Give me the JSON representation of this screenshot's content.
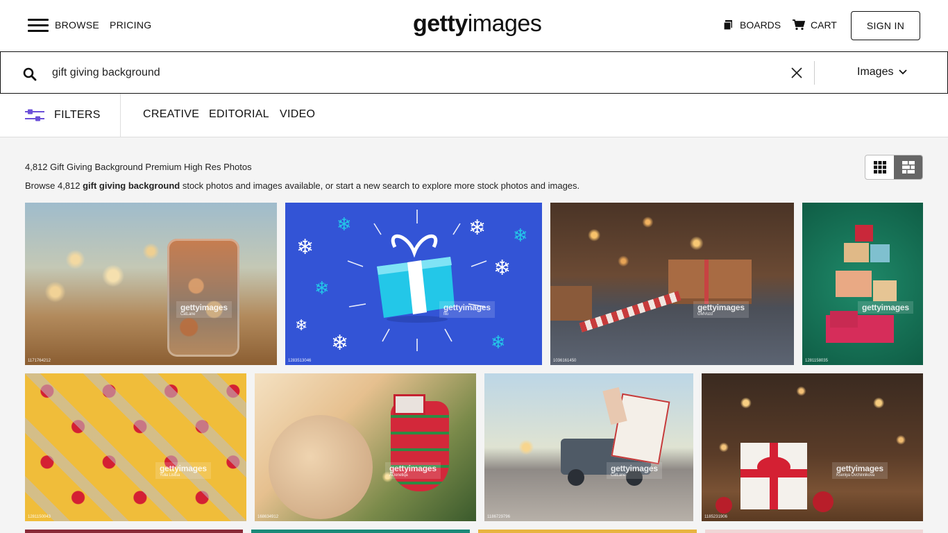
{
  "nav": {
    "browse": "BROWSE",
    "pricing": "PRICING",
    "logo_bold": "getty",
    "logo_light": "images",
    "boards": "BOARDS",
    "cart": "CART",
    "signin": "SIGN IN"
  },
  "search": {
    "query": "gift giving background",
    "media_type": "Images"
  },
  "filters": {
    "label": "FILTERS",
    "tabs": [
      "CREATIVE",
      "EDITORIAL",
      "VIDEO"
    ]
  },
  "results": {
    "title": "4,812 Gift Giving Background Premium High Res Photos",
    "sub_prefix": "Browse 4,812 ",
    "sub_bold": "gift giving background",
    "sub_suffix": " stock photos and images available, or start a new search to explore more stock photos and images."
  },
  "images": [
    {
      "id": "1171764212",
      "credit": "CatLane",
      "desc": "coin jar with bokeh"
    },
    {
      "id": "1283513046",
      "credit": "filo",
      "desc": "blue gift box illustration"
    },
    {
      "id": "1036161450",
      "credit": "GMVozd",
      "desc": "christmas gift on table"
    },
    {
      "id": "1281158035",
      "credit": "",
      "desc": "gift box tree on green"
    },
    {
      "id": "1281150043",
      "credit": "Yulia Lisitsa",
      "desc": "gift pattern on yellow"
    },
    {
      "id": "168634912",
      "credit": "AGenetiqa",
      "desc": "christmas stocking"
    },
    {
      "id": "1186729796",
      "credit": "CatLane",
      "desc": "truck with give tag"
    },
    {
      "id": "1185231906",
      "credit": "Kseniya Ovchinnikova",
      "desc": "white gift with red ribbon"
    }
  ],
  "watermark": "gettyimages",
  "colors": {
    "accent": "#6b4fd8",
    "main_bg": "#f4f4f4"
  }
}
